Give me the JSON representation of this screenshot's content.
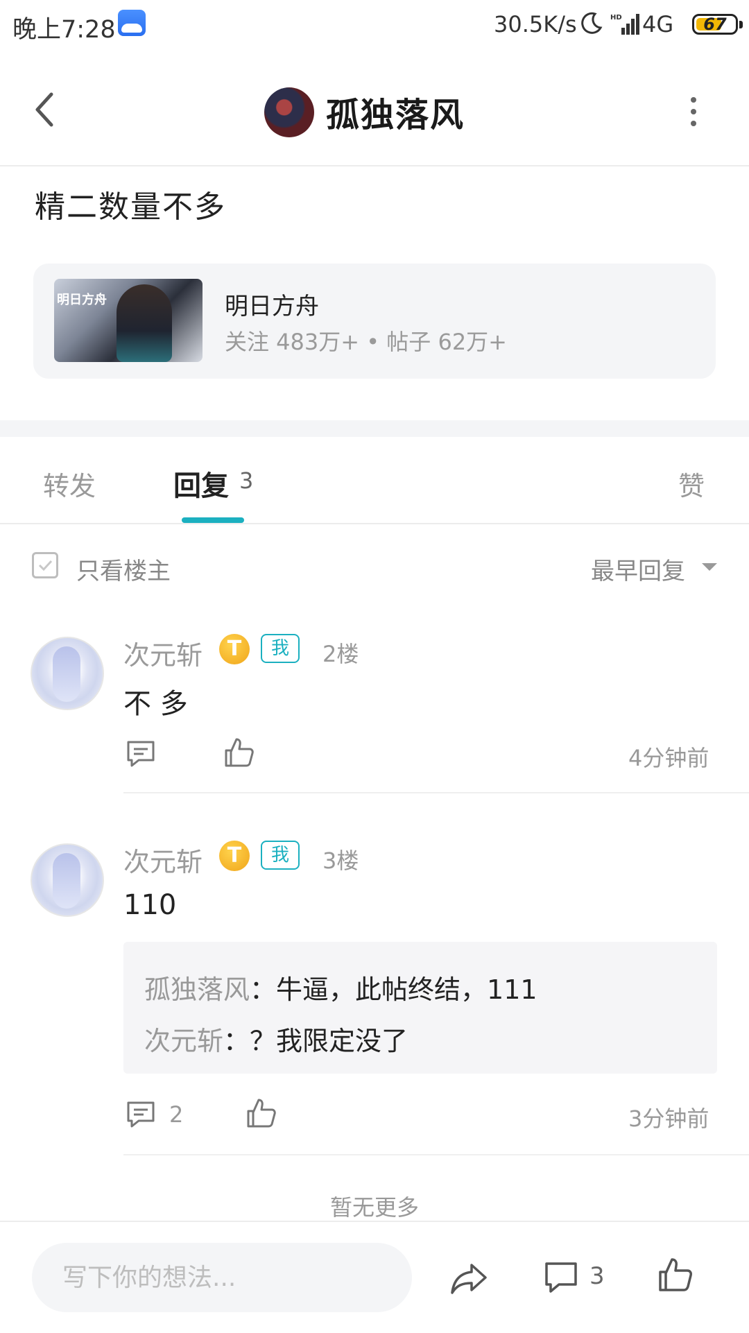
{
  "status_bar": {
    "time": "晚上7:28",
    "speed": "30.5K/s",
    "network": "4G",
    "battery": 67,
    "battery_text": "67"
  },
  "header": {
    "title": "孤独落风"
  },
  "post": {
    "text": "精二数量不多",
    "community": {
      "name": "明日方舟",
      "stats": "关注 483万+ • 帖子 62万+"
    }
  },
  "tabs": {
    "forward": "转发",
    "reply": "回复",
    "reply_count": "3",
    "like": "赞"
  },
  "filter": {
    "only_op": "只看楼主",
    "sort": "最早回复"
  },
  "comments": [
    {
      "user": "次元斩",
      "level": "T",
      "me_badge": "我",
      "floor": "2楼",
      "text": "不 多",
      "time": "4分钟前",
      "reply_count": ""
    },
    {
      "user": "次元斩",
      "level": "T",
      "me_badge": "我",
      "floor": "3楼",
      "text": "110",
      "replies": [
        {
          "user": "孤独落风",
          "text": "：牛逼，此帖终结，111"
        },
        {
          "user": "次元斩",
          "text": "：？我限定没了"
        }
      ],
      "reply_count": "2",
      "time": "3分钟前"
    }
  ],
  "no_more": "暂无更多",
  "bottom_bar": {
    "placeholder": "写下你的想法...",
    "comment_count": "3"
  },
  "colors": {
    "accent": "#1bb0c0",
    "level_badge": "#f0a51a",
    "battery": "#f2b705"
  }
}
